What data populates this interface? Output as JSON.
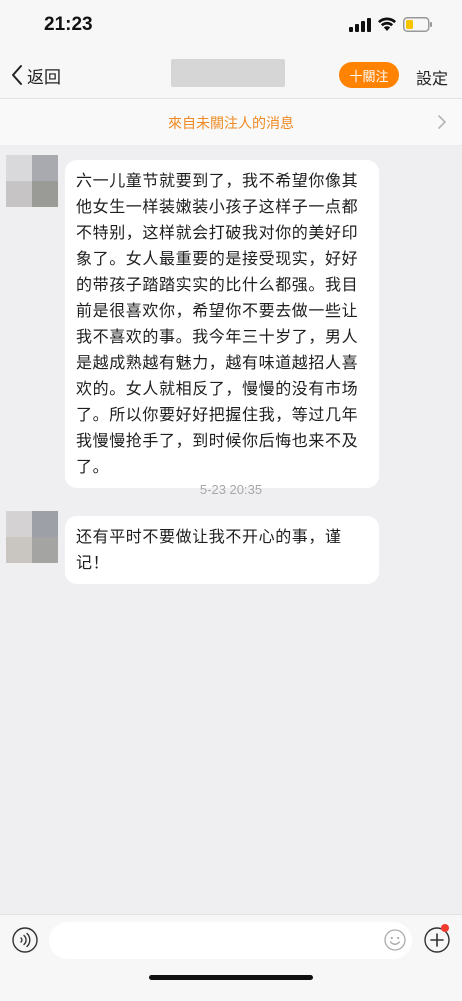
{
  "status_bar": {
    "time": "21:23"
  },
  "nav": {
    "back_label": "返回",
    "follow_label": "十關注",
    "settings_label": "設定"
  },
  "banner": {
    "text": "來自未關注人的消息"
  },
  "messages": [
    {
      "text": "六一儿童节就要到了，我不希望你像其他女生一样装嫩装小孩子这样子一点都不特别，这样就会打破我对你的美好印象了。女人最重要的是接受现实，好好的带孩子踏踏实实的比什么都强。我目前是很喜欢你，希望你不要去做一些让我不喜欢的事。我今年三十岁了，男人是越成熟越有魅力，越有味道越招人喜欢的。女人就相反了，慢慢的没有市场了。所以你要好好把握住我，等过几年我慢慢抢手了，到时候你后悔也来不及了。"
    },
    {
      "text": "还有平时不要做让我不开心的事，谨记！"
    }
  ],
  "timestamp": "5-23 20:35",
  "colors": {
    "accent": "#ff8200",
    "banner_text": "#f08a24",
    "background": "#efeff1"
  },
  "icons": {
    "back": "chevron-left-icon",
    "banner_arrow": "chevron-right-icon",
    "voice": "voice-icon",
    "emoji": "emoji-icon",
    "plus": "plus-icon"
  }
}
